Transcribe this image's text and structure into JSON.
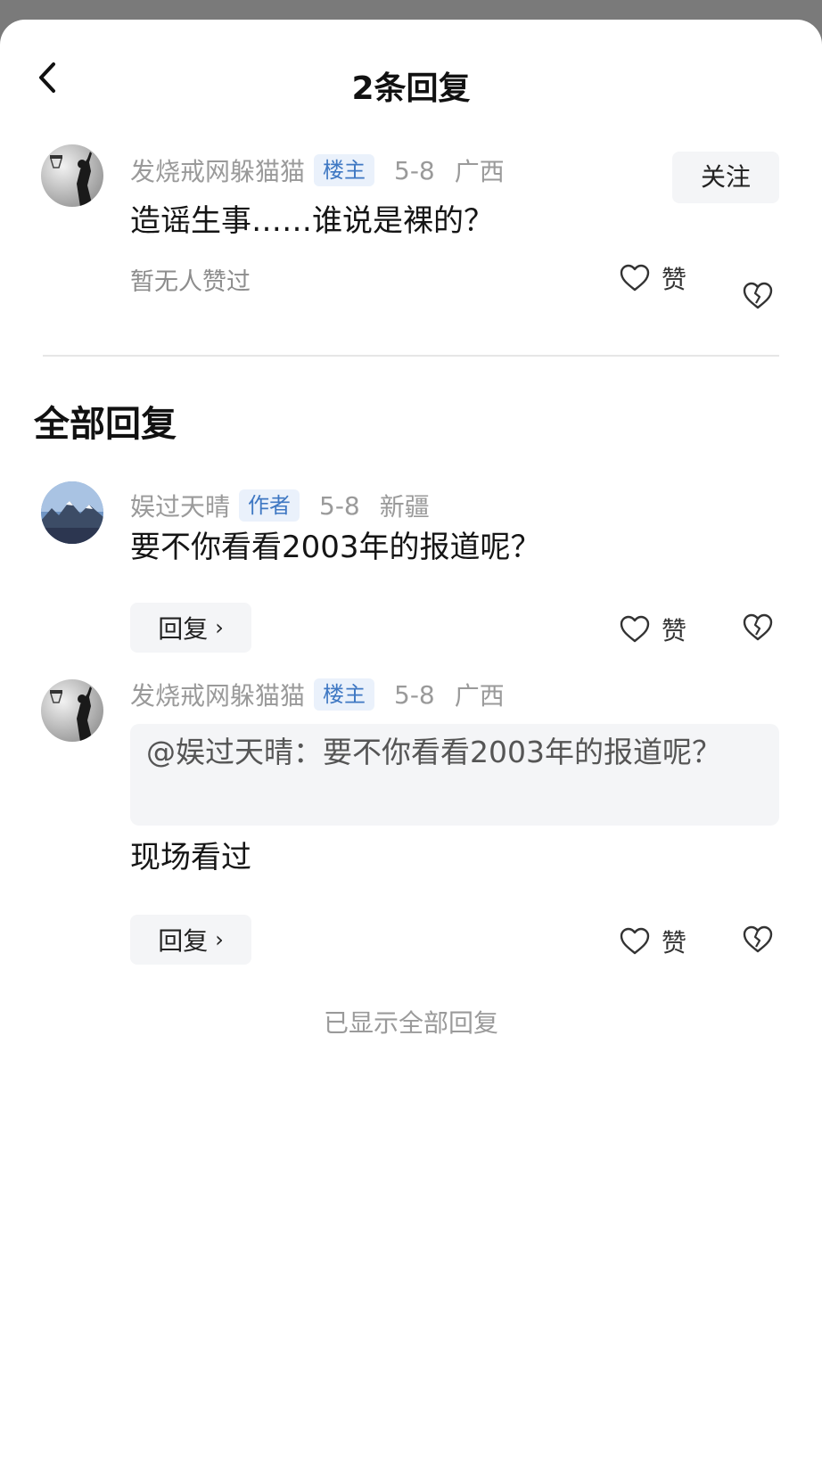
{
  "header": {
    "title": "2条回复",
    "back_icon": "chevron-left-icon"
  },
  "main_comment": {
    "username": "发烧戒网躲猫猫",
    "badge": "楼主",
    "date": "5-8",
    "location": "广西",
    "follow_label": "关注",
    "content": "造谣生事……谁说是裸的？",
    "likes_summary": "暂无人赞过",
    "like_label": "赞"
  },
  "section_title": "全部回复",
  "replies": [
    {
      "username": "娱过天晴",
      "badge": "作者",
      "date": "5-8",
      "location": "新疆",
      "content": "要不你看看2003年的报道呢？",
      "reply_label": "回复",
      "like_label": "赞"
    },
    {
      "username": "发烧戒网躲猫猫",
      "badge": "楼主",
      "date": "5-8",
      "location": "广西",
      "quote": "@娱过天晴：要不你看看2003年的报道呢？",
      "content": "现场看过",
      "reply_label": "回复",
      "like_label": "赞"
    }
  ],
  "footer_text": "已显示全部回复",
  "colors": {
    "badge_bg": "#eaf1fb",
    "badge_text": "#3f78c3",
    "muted": "#9a9a9a",
    "button_bg": "#f4f5f7"
  }
}
